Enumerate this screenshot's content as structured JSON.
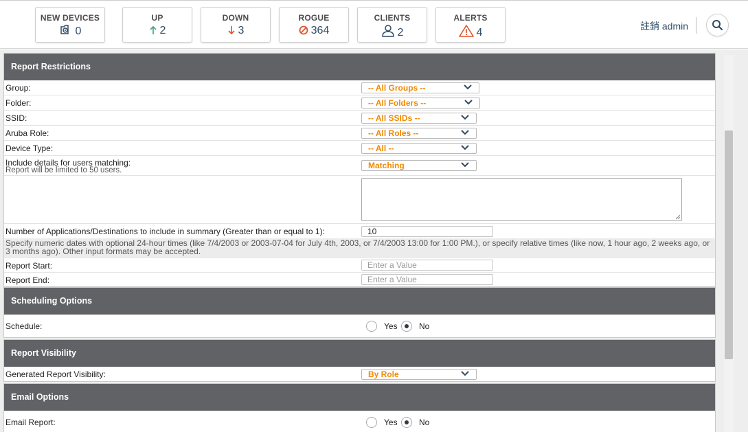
{
  "stats": [
    {
      "label": "NEW DEVICES",
      "value": "0",
      "icon": "camera-icon",
      "color": "#2f4a66"
    },
    {
      "label": "UP",
      "value": "2",
      "icon": "arrow-up-icon",
      "color": "#3aa57a"
    },
    {
      "label": "DOWN",
      "value": "3",
      "icon": "arrow-down-icon",
      "color": "#e0522a"
    },
    {
      "label": "ROGUE",
      "value": "364",
      "icon": "prohibited-icon",
      "color": "#e0522a"
    },
    {
      "label": "CLIENTS",
      "value": "2",
      "icon": "user-icon",
      "color": "#2f4a66"
    },
    {
      "label": "ALERTS",
      "value": "4",
      "icon": "warning-icon",
      "color": "#e0522a"
    }
  ],
  "user": {
    "label": "註銷 admin"
  },
  "report_restrictions": {
    "title": "Report Restrictions",
    "group": {
      "label": "Group:",
      "value": "-- All Groups --"
    },
    "folder": {
      "label": "Folder:",
      "value": "-- All Folders --"
    },
    "ssid": {
      "label": "SSID:",
      "value": "-- All SSIDs --"
    },
    "aruba_role": {
      "label": "Aruba Role:",
      "value": "-- All Roles --"
    },
    "device_type": {
      "label": "Device Type:",
      "value": "-- All --"
    },
    "include_details": {
      "label": "Include details for users matching:",
      "sublabel": "Report will be limited to 50 users.",
      "value": "Matching"
    },
    "num_apps": {
      "label": "Number of Applications/Destinations to include in summary (Greater than or equal to 1):",
      "value": "10"
    },
    "date_note": "Specify numeric dates with optional 24-hour times (like 7/4/2003 or 2003-07-04 for July 4th, 2003, or 7/4/2003 13:00 for 1:00 PM.), or specify relative times (like now, 1 hour ago, 2 weeks ago, or 3 months ago). Other input formats may be accepted.",
    "report_start": {
      "label": "Report Start:",
      "placeholder": "Enter a Value"
    },
    "report_end": {
      "label": "Report End:",
      "placeholder": "Enter a Value"
    }
  },
  "scheduling": {
    "title": "Scheduling Options",
    "label": "Schedule:",
    "yes": "Yes",
    "no": "No",
    "selected": "No"
  },
  "visibility": {
    "title": "Report Visibility",
    "label": "Generated Report Visibility:",
    "value": "By Role"
  },
  "email": {
    "title": "Email Options",
    "label": "Email Report:",
    "yes": "Yes",
    "no": "No",
    "selected": "No"
  }
}
